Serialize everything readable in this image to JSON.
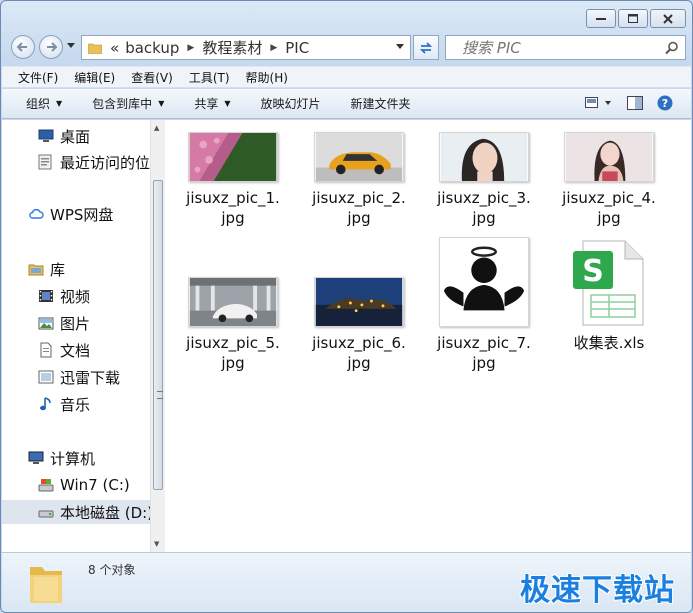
{
  "window": {
    "controls": [
      "minimize",
      "maximize",
      "close"
    ]
  },
  "address": {
    "overflow": "«",
    "crumbs": [
      "backup",
      "教程素材",
      "PIC"
    ]
  },
  "search": {
    "placeholder": "搜索 PIC"
  },
  "menubar": {
    "items": [
      "文件(F)",
      "编辑(E)",
      "查看(V)",
      "工具(T)",
      "帮助(H)"
    ]
  },
  "toolbar": {
    "organize": "组织",
    "include_in_library": "包含到库中",
    "share": "共享",
    "slideshow": "放映幻灯片",
    "new_folder": "新建文件夹"
  },
  "nav": {
    "desktop": "桌面",
    "recent": "最近访问的位置",
    "wps": "WPS网盘",
    "libraries": "库",
    "videos": "视频",
    "pictures": "图片",
    "documents": "文档",
    "thunder": "迅雷下载",
    "music": "音乐",
    "computer": "计算机",
    "drive_c": "Win7 (C:)",
    "drive_d": "本地磁盘 (D:)"
  },
  "files": [
    {
      "line1": "jisuxz_pic_1.",
      "line2": "jpg"
    },
    {
      "line1": "jisuxz_pic_2.",
      "line2": "jpg"
    },
    {
      "line1": "jisuxz_pic_3.",
      "line2": "jpg"
    },
    {
      "line1": "jisuxz_pic_4.",
      "line2": "jpg"
    },
    {
      "line1": "jisuxz_pic_5.",
      "line2": "jpg"
    },
    {
      "line1": "jisuxz_pic_6.",
      "line2": "jpg"
    },
    {
      "line1": "jisuxz_pic_7.",
      "line2": "jpg"
    },
    {
      "line1": "收集表.xls",
      "line2": ""
    }
  ],
  "status": {
    "count": "8 个对象"
  },
  "watermark": "极速下载站",
  "colors": {
    "accent": "#1a7fe0",
    "chrome": "#c6d9ee",
    "selected": "#dfe5ee"
  }
}
